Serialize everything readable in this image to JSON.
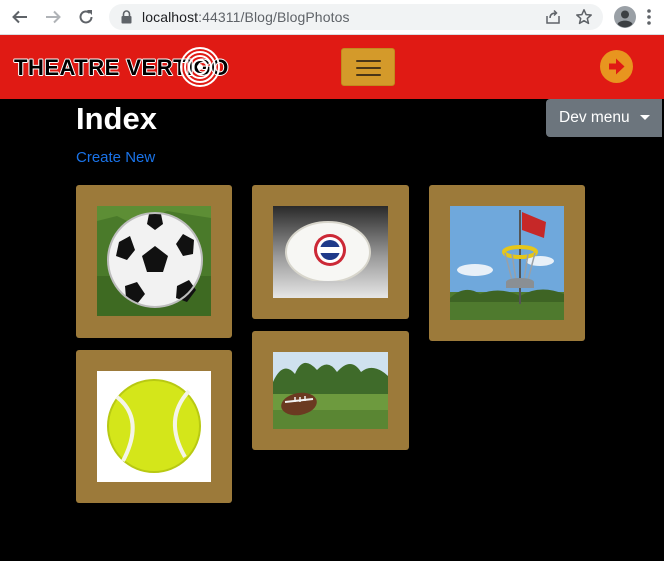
{
  "browser": {
    "url_host": "localhost",
    "url_port": ":44311",
    "url_path": "/Blog/BlogPhotos"
  },
  "header": {
    "logo_text": "THEATRE VERTIGO",
    "menu_toggle_label": "Toggle navigation",
    "login_label": "Log in"
  },
  "page": {
    "title": "Index",
    "create_link": "Create New",
    "dev_menu_label": "Dev menu"
  },
  "photos": [
    {
      "subject": "soccer-ball"
    },
    {
      "subject": "frisbee"
    },
    {
      "subject": "disc-golf-basket"
    },
    {
      "subject": "tennis-ball"
    },
    {
      "subject": "football"
    }
  ],
  "colors": {
    "header_red": "#e01a14",
    "card_gold": "#9c7a3a",
    "accent_orange": "#e8951f",
    "link_blue": "#1a73e8",
    "dev_menu_gray": "#6c757d"
  }
}
